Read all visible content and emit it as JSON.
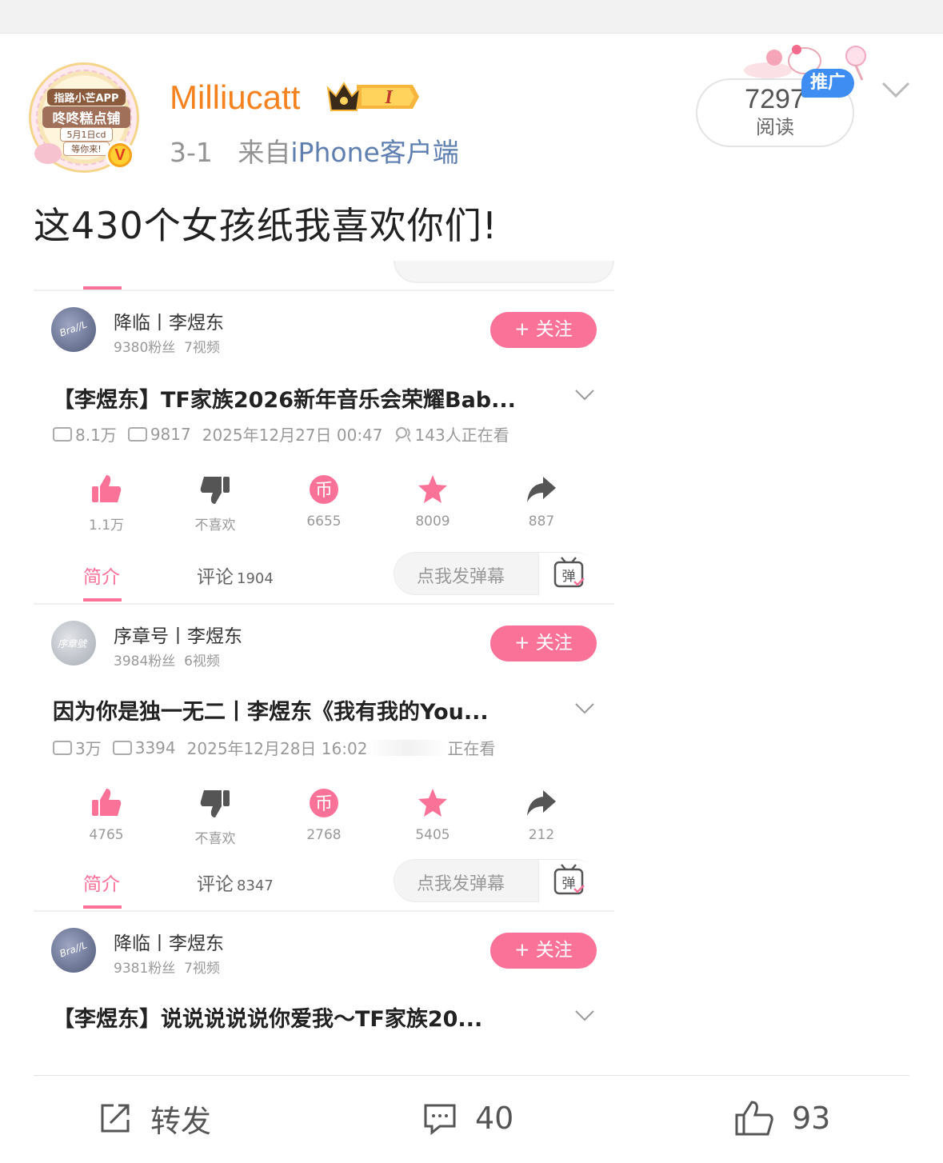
{
  "post": {
    "username": "Milliucatt",
    "level_badge": "I",
    "date": "3-1",
    "from_label": "来自",
    "source": "iPhone客户端",
    "reads_count": "7297",
    "reads_label": "阅读",
    "promo_label": "推广",
    "text": "这430个女孩纸我喜欢你们!"
  },
  "avatar_text": {
    "line1": "指路小芒APP",
    "line2": "咚咚糕点铺",
    "line3": "5月1日cd",
    "line4": "等你来!"
  },
  "embedded": {
    "blocks": [
      {
        "uploader": "降临丨李煜东",
        "fans": "9380粉丝",
        "videos": "7视频",
        "follow": "+ 关注",
        "title": "【李煜东】TF家族2026新年音乐会荣耀Bab...",
        "views": "8.1万",
        "danmaku": "9817",
        "datetime": "2025年12月27日 00:47",
        "watching": "143人正在看",
        "like": "1.1万",
        "dislike": "不喜欢",
        "coin": "6655",
        "fav": "8009",
        "share": "887",
        "tab_intro": "简介",
        "tab_comments": "评论",
        "comment_count": "1904",
        "danmu_placeholder": "点我发弹幕"
      },
      {
        "uploader": "序章号丨李煜东",
        "fans": "3984粉丝",
        "videos": "6视频",
        "follow": "+ 关注",
        "title": "因为你是独一无二丨李煜东《我有我的You...",
        "views": "3万",
        "danmaku": "3394",
        "datetime": "2025年12月28日 16:02",
        "watching": "正在看",
        "like": "4765",
        "dislike": "不喜欢",
        "coin": "2768",
        "fav": "5405",
        "share": "212",
        "tab_intro": "简介",
        "tab_comments": "评论",
        "comment_count": "8347",
        "danmu_placeholder": "点我发弹幕"
      },
      {
        "uploader": "降临丨李煜东",
        "fans": "9381粉丝",
        "videos": "7视频",
        "follow": "+ 关注",
        "title": "【李煜东】说说说说说你爱我～TF家族20..."
      }
    ],
    "danmu_icon_char": "弹",
    "accent_color": "#fb7299"
  },
  "footer": {
    "repost_label": "转发",
    "comment_count": "40",
    "like_count": "93"
  },
  "colors": {
    "username": "#f5821f",
    "source_link": "#5e7fb0",
    "promo": "#3e8df2"
  }
}
